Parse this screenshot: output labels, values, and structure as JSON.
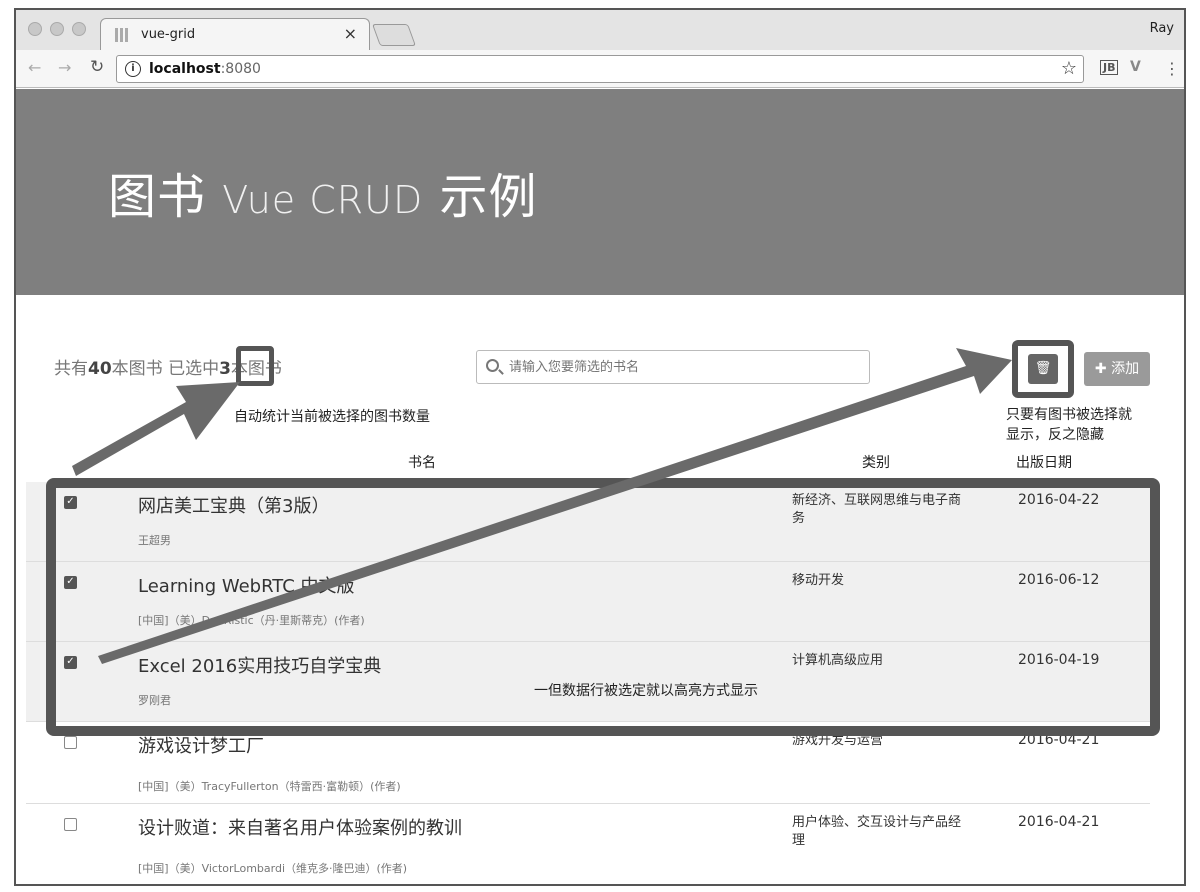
{
  "browser": {
    "tab_title": "vue-grid",
    "tab_close": "×",
    "profile": "Ray",
    "url_host": "localhost",
    "url_port": ":8080",
    "ext1": "JB",
    "ext2": "V",
    "menu": "⋮"
  },
  "hero": {
    "title_cn1": "图书",
    "title_latin": "Vue CRUD",
    "title_cn2": "示例"
  },
  "stats": {
    "prefix": "共有",
    "total": "40",
    "mid": "本图书  已选中",
    "selected": "3",
    "suffix": "本图书"
  },
  "search": {
    "placeholder": "请输入您要筛选的书名"
  },
  "actions": {
    "delete_icon": "🗑",
    "add_label": "✚ 添加"
  },
  "notes": {
    "count_note": "自动统计当前被选择的图书数量",
    "delete_note_1": "只要有图书被选择就",
    "delete_note_2": "显示，反之隐藏",
    "row_note": "一但数据行被选定就以高亮方式显示"
  },
  "table": {
    "headers": {
      "name": "书名",
      "category": "类别",
      "date": "出版日期"
    },
    "rows": [
      {
        "title": "网店美工宝典（第3版）",
        "author": "王超男",
        "category": "新经济、互联网思维与电子商务",
        "date": "2016-04-22",
        "checked": true
      },
      {
        "title": "Learning WebRTC 中文版",
        "author": "[中国]（美）DanRistic（丹·里斯蒂克）(作者)",
        "category": "移动开发",
        "date": "2016-06-12",
        "checked": true
      },
      {
        "title": "Excel 2016实用技巧自学宝典",
        "author": "罗刚君",
        "category": "计算机高级应用",
        "date": "2016-04-19",
        "checked": true
      },
      {
        "title": "游戏设计梦工厂",
        "author": "[中国]（美）TracyFullerton（特雷西·富勒顿）(作者)",
        "category": "游戏开发与运营",
        "date": "2016-04-21",
        "checked": false
      },
      {
        "title": "设计败道：来自著名用户体验案例的教训",
        "author": "[中国]（美）VictorLombardi（维克多·隆巴迪）(作者)",
        "category": "用户体验、交互设计与产品经理",
        "date": "2016-04-21",
        "checked": false
      }
    ]
  }
}
